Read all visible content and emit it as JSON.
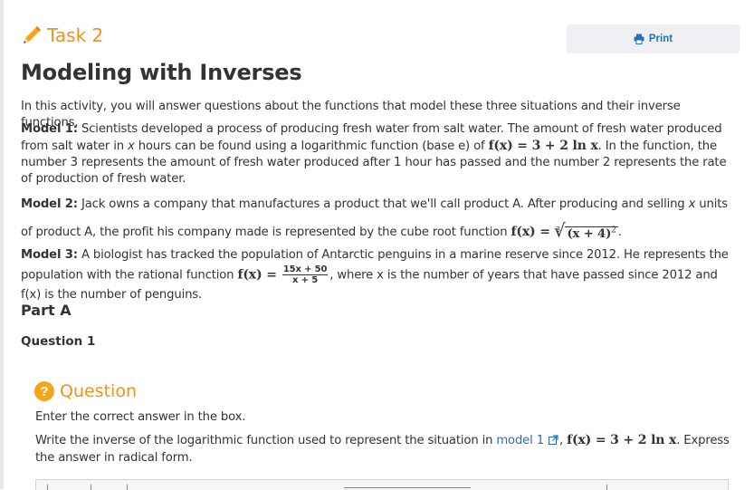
{
  "header": {
    "task_title": "Task 2",
    "print_label": "Print"
  },
  "page": {
    "title": "Modeling with Inverses",
    "intro": "In this activity, you will answer questions about the functions that model these three situations and their inverse functions."
  },
  "models": {
    "m1_label": "Model 1:",
    "m1_text_a": "Scientists developed a process of producing fresh water from salt water. The amount of fresh water produced from salt water in",
    "m1_var": "x",
    "m1_text_b": "hours can be found using a logarithmic function (base e) of",
    "m1_fx": "f(x) = 3 + 2 ln x",
    "m1_text_c": ". In the function, the number 3 represents the amount of fresh water produced after 1 hour has passed and the number 2 represents the rate of production of fresh water.",
    "m2_label": "Model 2:",
    "m2_text_a": "Jack owns a company that manufactures a product that we'll call product A. After producing and selling",
    "m2_var": "x",
    "m2_text_b": "units of product A, the profit his company made is represented by the cube root function",
    "m2_fx_lhs": "f(x) =",
    "m2_root_index": "3",
    "m2_radicand": "(x + 4)",
    "m2_exp": "2",
    "m3_label": "Model 3:",
    "m3_text_a": "A biologist has tracked the population of Antarctic penguins in a marine reserve since 2012. He represents the population with the rational function",
    "m3_fx_lhs": "f(x) =",
    "m3_num": "15x + 50",
    "m3_den": "x + 5",
    "m3_text_b": ", where x is the number of years that have passed since 2012 and f(x) is the number of penguins."
  },
  "part": {
    "label": "Part A",
    "question_label": "Question 1"
  },
  "question": {
    "heading": "Question",
    "instruction": "Enter the correct answer in the box.",
    "text_a": "Write the inverse of the logarithmic function used to represent the situation in",
    "link": "model 1",
    "text_b": ", ",
    "fx": "f(x) = 3 + 2 ln x",
    "text_c": ". Express the answer in radical form."
  },
  "colors": {
    "accent_orange": "#f0931a",
    "link_blue": "#2a6fb5",
    "print_bg": "#eef0f3"
  }
}
